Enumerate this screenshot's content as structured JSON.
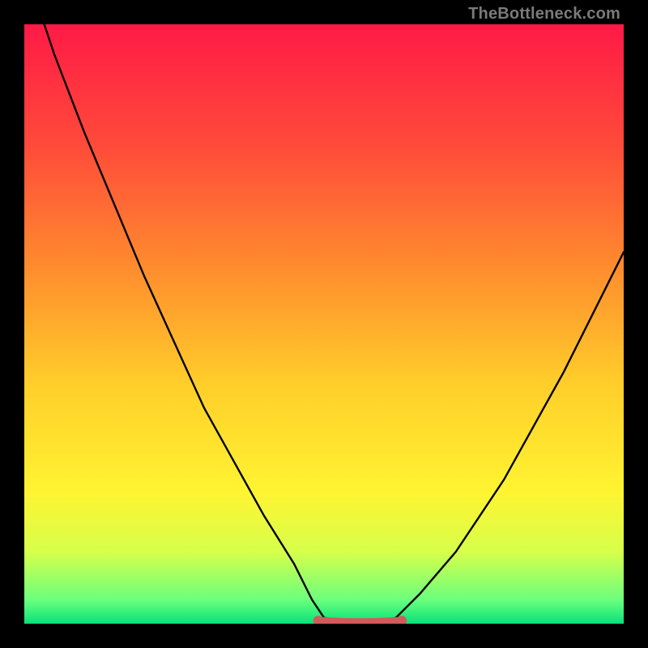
{
  "watermark": "TheBottleneck.com",
  "chart_data": {
    "type": "line",
    "title": "",
    "xlabel": "",
    "ylabel": "",
    "xlim": [
      0,
      100
    ],
    "ylim": [
      0,
      100
    ],
    "grid": false,
    "legend": false,
    "gradient_stops": [
      {
        "offset": 0,
        "color": "#ff1a46"
      },
      {
        "offset": 20,
        "color": "#ff4a3a"
      },
      {
        "offset": 40,
        "color": "#ff8a2e"
      },
      {
        "offset": 60,
        "color": "#ffce2a"
      },
      {
        "offset": 78,
        "color": "#fff431"
      },
      {
        "offset": 88,
        "color": "#d7ff4a"
      },
      {
        "offset": 96,
        "color": "#6cff7d"
      },
      {
        "offset": 100,
        "color": "#06e27a"
      }
    ],
    "curve": {
      "comment": "V-shaped bottleneck curve, y is mismatch % (0 = optimal), x is relative component balance",
      "x": [
        0,
        5,
        10,
        15,
        20,
        25,
        30,
        35,
        40,
        45,
        48,
        50,
        55,
        58,
        62,
        66,
        72,
        80,
        90,
        100
      ],
      "y": [
        110,
        95,
        82,
        70,
        58,
        47,
        36,
        27,
        18,
        10,
        4,
        1,
        0,
        0,
        1,
        5,
        12,
        24,
        42,
        62
      ]
    },
    "flat_region": {
      "comment": "Red/pink thick segment marking near-zero mismatch zone",
      "x_start": 49,
      "x_end": 63,
      "y": 0.5,
      "color": "#d15a5a"
    }
  }
}
